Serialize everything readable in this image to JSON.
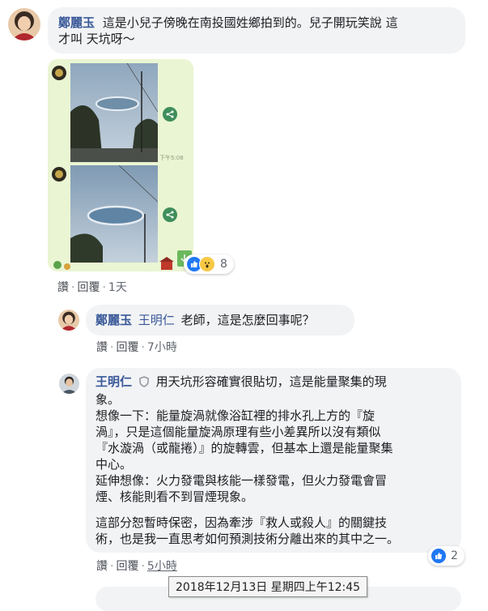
{
  "comment1": {
    "author": "鄭麗玉",
    "text_line1": "這是小兒子傍晚在南投國姓鄉拍到的。兒子開玩笑說 這",
    "text_line2": "才叫 天坑呀～",
    "image": {
      "timestamp": "下午5:08"
    },
    "reaction_count": "8",
    "actions": {
      "like": "讚",
      "reply": "回覆",
      "time": "1天"
    }
  },
  "reply1": {
    "author": "鄭麗玉",
    "mention": "王明仁",
    "text": "老師，這是怎麼回事呢？",
    "actions": {
      "like": "讚",
      "reply": "回覆",
      "time": "7小時"
    }
  },
  "reply2": {
    "author": "王明仁",
    "text_lines": [
      "用天坑形容確實很貼切，這是能量聚集的現",
      "象。",
      "想像一下：能量旋渦就像浴缸裡的排水孔上方的『旋",
      "渦』，只是這個能量旋渦原理有些小差異所以沒有類似",
      "『水漩渦（或龍捲）』的旋轉雲，但基本上還是能量聚集",
      "中心。",
      "延伸想像：火力發電與核能一樣發電，但火力發電會冒",
      "煙、核能則看不到冒煙現象。",
      "這部分恕暫時保密，因為牽涉『救人或殺人』的關鍵技",
      "術，也是我一直思考如何預測技術分離出來的其中之一。"
    ],
    "reaction_count": "2",
    "actions": {
      "like": "讚",
      "reply": "回覆",
      "time": "5小時"
    }
  },
  "tooltip": "2018年12月13日 星期四上午12:45",
  "colors": {
    "name_blue": "#385898",
    "bubble_gray": "#f2f3f5",
    "like_blue": "#2078f4",
    "line_green_bg": "#eaf5d3"
  }
}
